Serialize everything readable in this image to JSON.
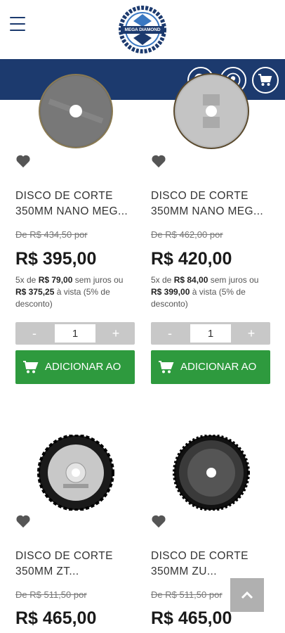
{
  "header": {
    "logo_text": "MEGA DIAMOND"
  },
  "colors": {
    "brand_blue": "#1c3a6e",
    "add_green": "#2e9a3e",
    "stepper_gray": "#c8c8c8"
  },
  "icons": {
    "menu": "hamburger-icon",
    "search": "search-icon",
    "user": "user-icon",
    "cart": "cart-icon",
    "wishlist": "heart-icon",
    "back_to_top": "chevron-up-icon"
  },
  "products": [
    {
      "title": "DISCO DE CORTE 350MM NANO MEG...",
      "old_price": "De R$ 434,50 por",
      "price": "R$ 395,00",
      "inst_prefix": "5x de ",
      "inst_value": "R$ 79,00",
      "inst_mid": " sem juros ou ",
      "cash_value": "R$ 375,25",
      "inst_suffix": " à vista (5% de desconto)",
      "quantity": "1",
      "minus": "-",
      "plus": "+",
      "add_label": "ADICIONAR AO"
    },
    {
      "title": "DISCO DE CORTE 350MM NANO MEG...",
      "old_price": "De R$ 462,00 por",
      "price": "R$ 420,00",
      "inst_prefix": "5x de ",
      "inst_value": "R$ 84,00",
      "inst_mid": " sem juros ou ",
      "cash_value": "R$ 399,00",
      "inst_suffix": " à vista (5% de desconto)",
      "quantity": "1",
      "minus": "-",
      "plus": "+",
      "add_label": "ADICIONAR AO"
    },
    {
      "title": "DISCO DE CORTE 350MM ZT...",
      "old_price": "De R$ 511,50 por",
      "price": "R$ 465,00"
    },
    {
      "title": "DISCO DE CORTE 350MM ZU...",
      "old_price": "De R$ 511,50 por",
      "price": "R$ 465,00"
    }
  ]
}
